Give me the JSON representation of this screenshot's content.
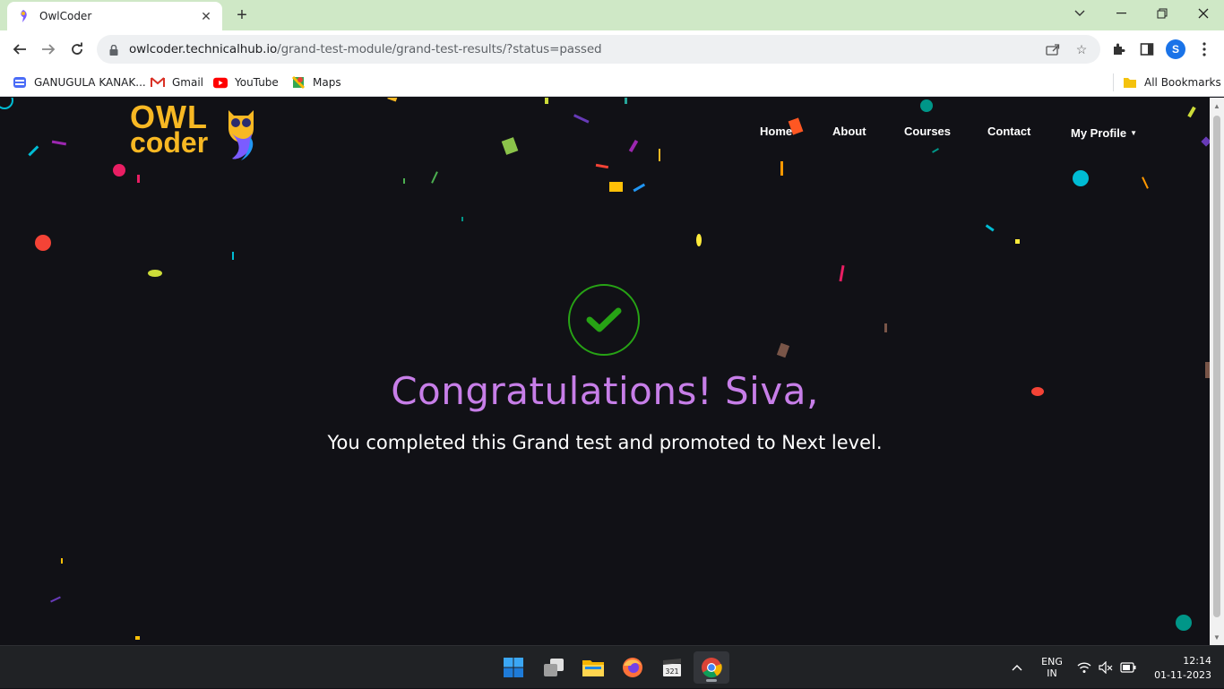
{
  "browser": {
    "tab_title": "OwlCoder",
    "url_host": "owlcoder.technicalhub.io",
    "url_path": "/grand-test-module/grand-test-results/?status=passed",
    "profile_initial": "S"
  },
  "bookmarks": [
    {
      "label": "GANUGULA KANAK...",
      "icon": "bookmark-app-icon"
    },
    {
      "label": "Gmail",
      "icon": "gmail-icon"
    },
    {
      "label": "YouTube",
      "icon": "youtube-icon"
    },
    {
      "label": "Maps",
      "icon": "maps-icon"
    }
  ],
  "all_bookmarks_label": "All Bookmarks",
  "site": {
    "logo_line1": "OWL",
    "logo_line2": "coder",
    "nav": {
      "home": "Home",
      "about": "About",
      "courses": "Courses",
      "contact": "Contact",
      "profile": "My Profile"
    },
    "congrats_title": "Congratulations! Siva,",
    "congrats_message": "You completed this Grand test and promoted to Next level."
  },
  "taskbar": {
    "lang_line1": "ENG",
    "lang_line2": "IN",
    "time": "12:14",
    "date": "01-11-2023"
  },
  "colors": {
    "accent_purple": "#c77ee8",
    "success_green": "#27a315",
    "logo_yellow": "#f8b823",
    "page_bg": "#111116"
  }
}
